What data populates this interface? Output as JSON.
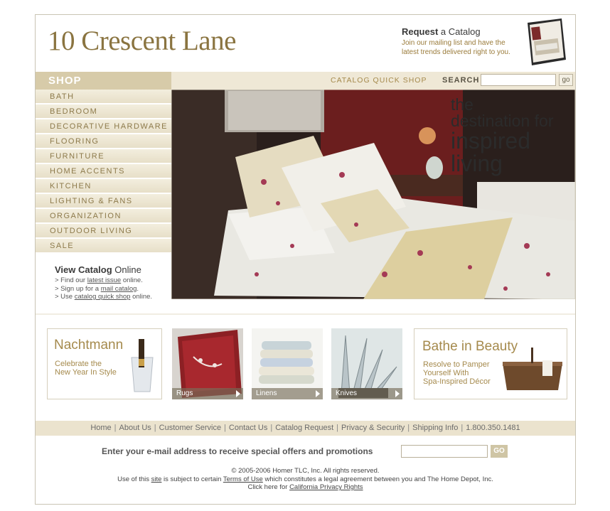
{
  "header": {
    "logo": "10 Crescent Lane",
    "request_bold": "Request",
    "request_rest": " a Catalog",
    "request_text": "Join our mailing list and have the latest trends delivered right to you."
  },
  "topbar": {
    "shop": "SHOP",
    "catalog_quick_shop": "CATALOG QUICK SHOP",
    "search_label": "SEARCH",
    "go": "go"
  },
  "nav": [
    "BATH",
    "BEDROOM",
    "DECORATIVE HARDWARE",
    "FLOORING",
    "FURNITURE",
    "HOME ACCENTS",
    "KITCHEN",
    "LIGHTING & FANS",
    "ORGANIZATION",
    "OUTDOOR LIVING",
    "SALE"
  ],
  "view_catalog": {
    "bold": "View Catalog",
    "rest": " Online",
    "l1_pre": "> Find our ",
    "l1_link": "latest issue",
    "l1_post": " online.",
    "l2_pre": "> Sign up for a ",
    "l2_link": "mail catalog",
    "l2_post": ".",
    "l3_pre": "> Use ",
    "l3_link": "catalog quick shop",
    "l3_post": " online."
  },
  "hero": {
    "line1": "the",
    "line2": "destination for",
    "line3": "inspired",
    "line4": "living"
  },
  "promos": {
    "left_title": "Nachtmann",
    "left_sub1": "Celebrate the",
    "left_sub2": "New Year In Style",
    "right_title": "Bathe in Beauty",
    "right_sub1": "Resolve to Pamper",
    "right_sub2": "Yourself With",
    "right_sub3": "Spa-Inspired Décor"
  },
  "tiles": [
    "Rugs",
    "Linens",
    "Knives"
  ],
  "footer": {
    "links": [
      "Home",
      "About Us",
      "Customer Service",
      "Contact Us",
      "Catalog Request",
      "Privacy & Security",
      "Shipping Info",
      "1.800.350.1481"
    ],
    "email_label": "Enter your e-mail address to receive special offers and promotions",
    "email_go": "GO",
    "copyright": "© 2005-2006 Homer TLC, Inc. All rights reserved.",
    "terms_pre": "Use of this ",
    "terms_site": "site",
    "terms_mid": " is subject to certain ",
    "terms_link": "Terms of Use",
    "terms_post": " which constitutes a legal agreement between you and The Home Depot, Inc.",
    "privacy_pre": "Click here for ",
    "privacy_link": "California Privacy Rights"
  }
}
